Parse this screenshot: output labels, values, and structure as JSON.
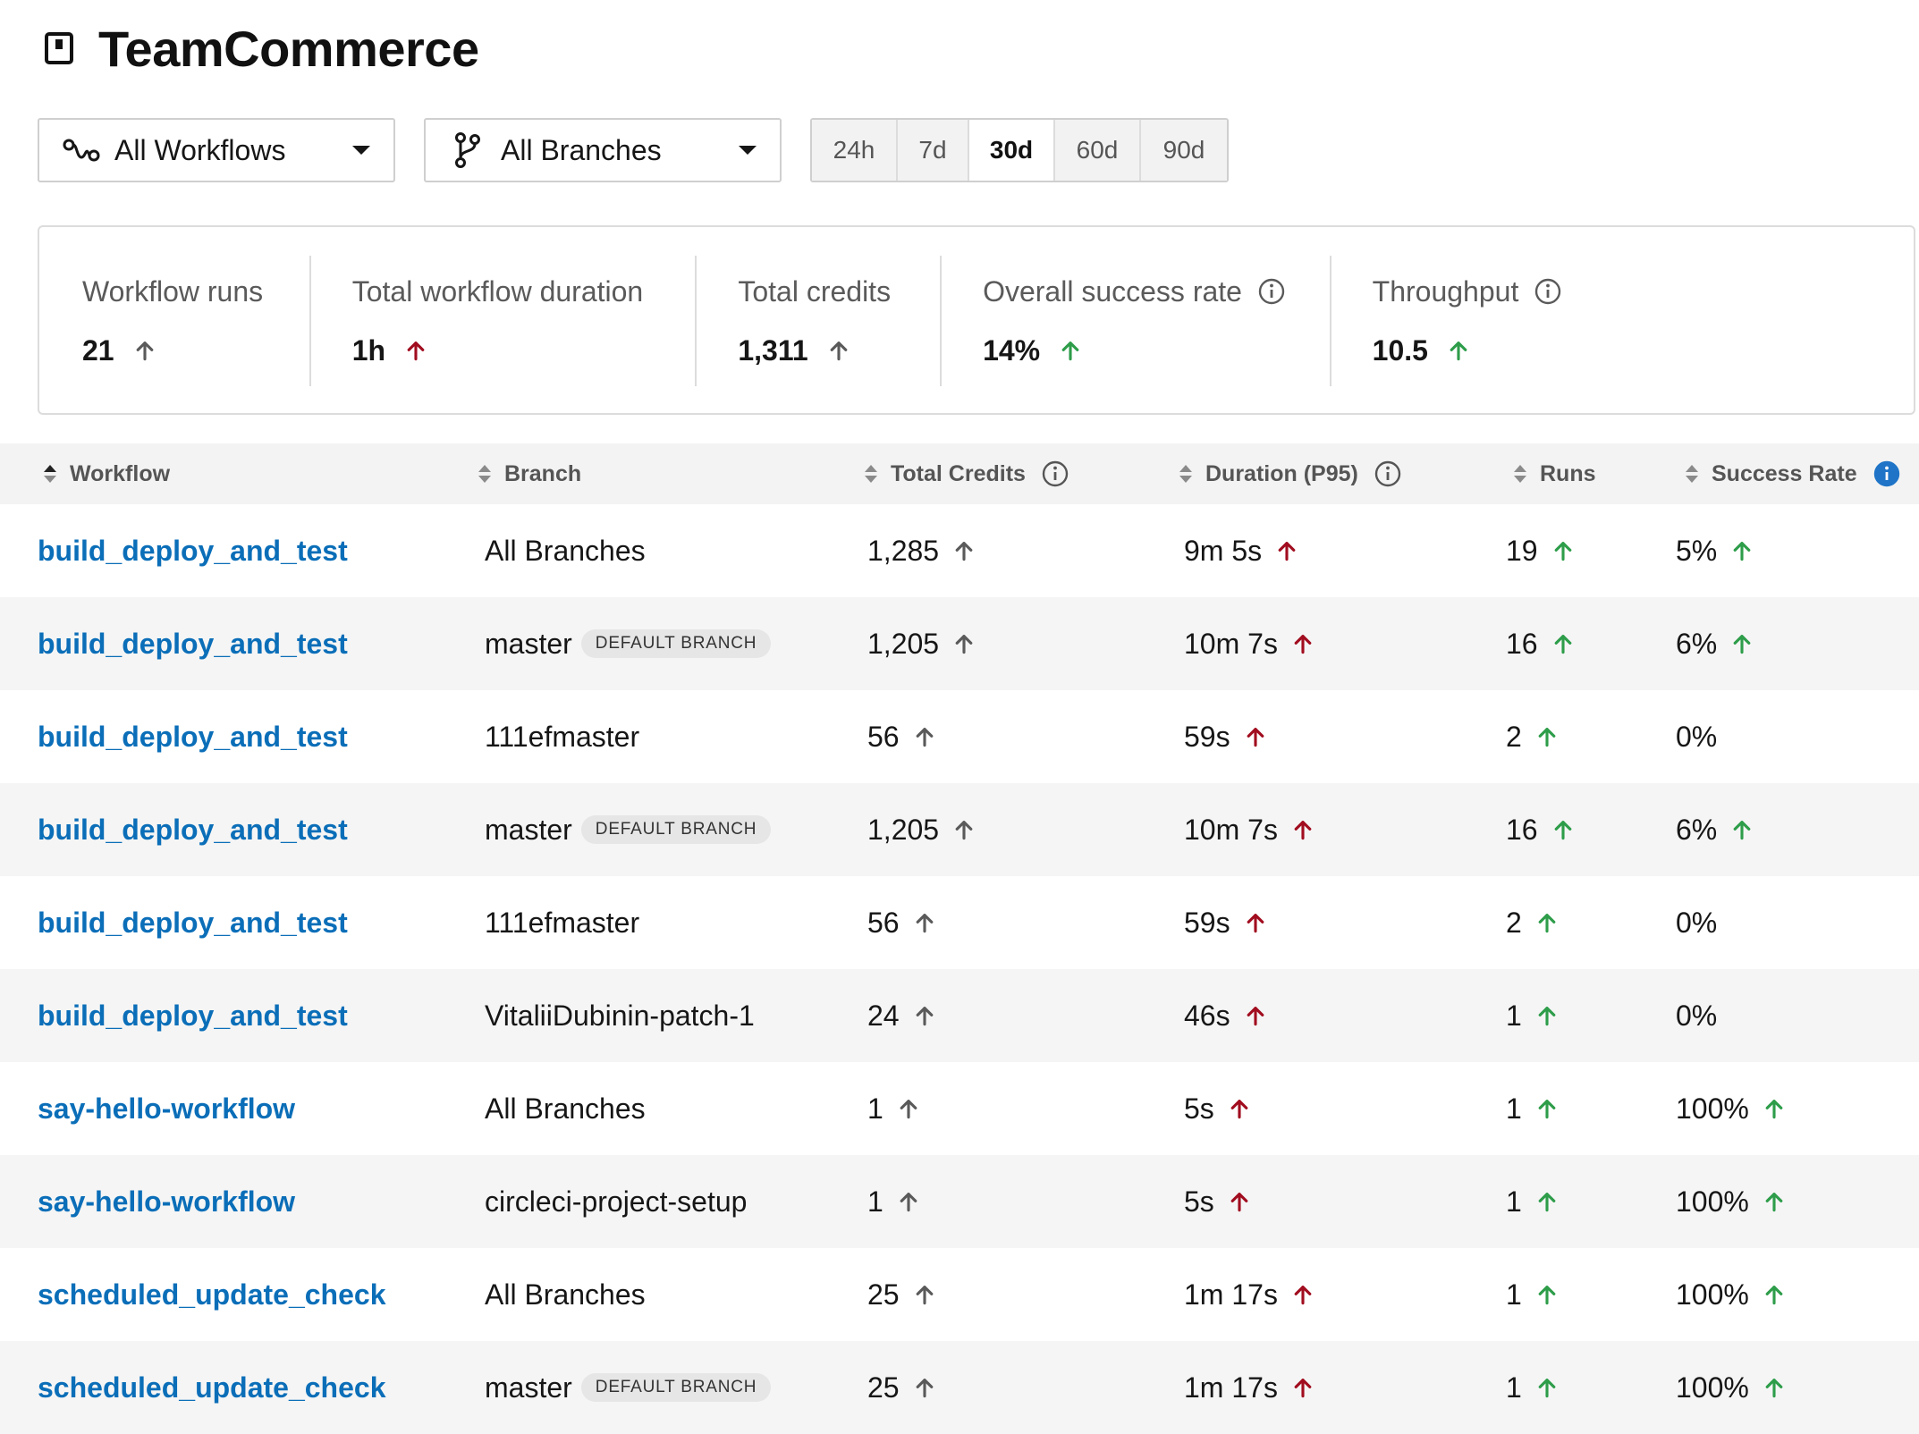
{
  "header": {
    "title": "TeamCommerce",
    "icon": "project-icon"
  },
  "filters": {
    "workflows_label": "All Workflows",
    "branches_label": "All Branches",
    "ranges": [
      "24h",
      "7d",
      "30d",
      "60d",
      "90d"
    ],
    "active_range": "30d"
  },
  "stats": [
    {
      "label": "Workflow runs",
      "value": "21",
      "trend": "up",
      "trend_color": "#5a5a5a",
      "info": false
    },
    {
      "label": "Total workflow duration",
      "value": "1h",
      "trend": "up",
      "trend_color": "#a10d1f",
      "info": false
    },
    {
      "label": "Total credits",
      "value": "1,311",
      "trend": "up",
      "trend_color": "#5a5a5a",
      "info": false
    },
    {
      "label": "Overall success rate",
      "value": "14%",
      "trend": "up",
      "trend_color": "#2e9d4a",
      "info": true
    },
    {
      "label": "Throughput",
      "value": "10.5",
      "trend": "up",
      "trend_color": "#2e9d4a",
      "info": true
    }
  ],
  "table": {
    "columns": [
      {
        "label": "Workflow",
        "info": false
      },
      {
        "label": "Branch",
        "info": false
      },
      {
        "label": "Total Credits",
        "info": true
      },
      {
        "label": "Duration (P95)",
        "info": true
      },
      {
        "label": "Runs",
        "info": false
      },
      {
        "label": "Success Rate",
        "info": true
      }
    ],
    "default_badge": "DEFAULT BRANCH",
    "rows": [
      {
        "workflow": "build_deploy_and_test",
        "branch": "All Branches",
        "default": false,
        "credits": "1,285",
        "credits_trend": true,
        "duration": "9m 5s",
        "duration_trend": true,
        "runs": "19",
        "runs_trend": true,
        "success": "5%",
        "success_trend": true
      },
      {
        "workflow": "build_deploy_and_test",
        "branch": "master",
        "default": true,
        "credits": "1,205",
        "credits_trend": true,
        "duration": "10m 7s",
        "duration_trend": true,
        "runs": "16",
        "runs_trend": true,
        "success": "6%",
        "success_trend": true
      },
      {
        "workflow": "build_deploy_and_test",
        "branch": "111efmaster",
        "default": false,
        "credits": "56",
        "credits_trend": true,
        "duration": "59s",
        "duration_trend": true,
        "runs": "2",
        "runs_trend": true,
        "success": "0%",
        "success_trend": false
      },
      {
        "workflow": "build_deploy_and_test",
        "branch": "master",
        "default": true,
        "credits": "1,205",
        "credits_trend": true,
        "duration": "10m 7s",
        "duration_trend": true,
        "runs": "16",
        "runs_trend": true,
        "success": "6%",
        "success_trend": true
      },
      {
        "workflow": "build_deploy_and_test",
        "branch": "111efmaster",
        "default": false,
        "credits": "56",
        "credits_trend": true,
        "duration": "59s",
        "duration_trend": true,
        "runs": "2",
        "runs_trend": true,
        "success": "0%",
        "success_trend": false
      },
      {
        "workflow": "build_deploy_and_test",
        "branch": "VitaliiDubinin-patch-1",
        "default": false,
        "credits": "24",
        "credits_trend": true,
        "duration": "46s",
        "duration_trend": true,
        "runs": "1",
        "runs_trend": true,
        "success": "0%",
        "success_trend": false
      },
      {
        "workflow": "say-hello-workflow",
        "branch": "All Branches",
        "default": false,
        "credits": "1",
        "credits_trend": true,
        "duration": "5s",
        "duration_trend": true,
        "runs": "1",
        "runs_trend": true,
        "success": "100%",
        "success_trend": true
      },
      {
        "workflow": "say-hello-workflow",
        "branch": "circleci-project-setup",
        "default": false,
        "credits": "1",
        "credits_trend": true,
        "duration": "5s",
        "duration_trend": true,
        "runs": "1",
        "runs_trend": true,
        "success": "100%",
        "success_trend": true
      },
      {
        "workflow": "scheduled_update_check",
        "branch": "All Branches",
        "default": false,
        "credits": "25",
        "credits_trend": true,
        "duration": "1m 17s",
        "duration_trend": true,
        "runs": "1",
        "runs_trend": true,
        "success": "100%",
        "success_trend": true
      },
      {
        "workflow": "scheduled_update_check",
        "branch": "master",
        "default": true,
        "credits": "25",
        "credits_trend": true,
        "duration": "1m 17s",
        "duration_trend": true,
        "runs": "1",
        "runs_trend": true,
        "success": "100%",
        "success_trend": true
      }
    ]
  },
  "colors": {
    "link": "#0b6eb8",
    "trend_neutral": "#5a5a5a",
    "trend_bad": "#a10d1f",
    "trend_good": "#2e9d4a",
    "info_active": "#1f74c7"
  }
}
